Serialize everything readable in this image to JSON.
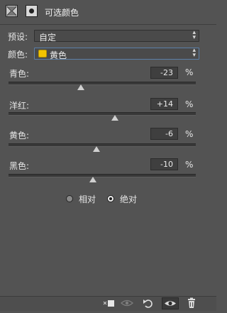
{
  "header": {
    "title": "可选颜色",
    "grid_icon": "adjustment-layer-icon",
    "mask_icon": "layer-mask-icon"
  },
  "preset": {
    "label": "预设:",
    "value": "自定"
  },
  "colors": {
    "label": "颜色:",
    "value": "黄色",
    "swatch_color": "#f2c400"
  },
  "sliders": [
    {
      "label": "青色:",
      "value": "-23",
      "unit": "%",
      "level": -23
    },
    {
      "label": "洋红:",
      "value": "+14",
      "unit": "%",
      "level": 14
    },
    {
      "label": "黄色:",
      "value": "-6",
      "unit": "%",
      "level": -6
    },
    {
      "label": "黑色:",
      "value": "-10",
      "unit": "%",
      "level": -10
    }
  ],
  "method": {
    "relative_label": "相对",
    "absolute_label": "绝对",
    "selected": "absolute"
  },
  "footer": {
    "icons": [
      "clip-to-layer-icon",
      "view-previous-state-icon",
      "reset-icon",
      "visibility-eye-icon",
      "trash-icon"
    ]
  }
}
